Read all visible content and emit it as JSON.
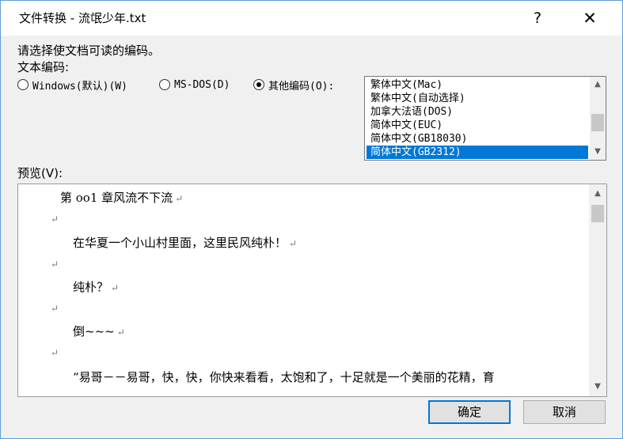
{
  "window": {
    "title": "文件转换 - 流氓少年.txt",
    "help_label": "?",
    "close_label": "✕"
  },
  "prompt": "请选择使文档可读的编码。",
  "encoding_label": "文本编码:",
  "radios": [
    {
      "label": "Windows(默认)(W)",
      "selected": false
    },
    {
      "label": "MS-DOS(D)",
      "selected": false
    },
    {
      "label": "其他编码(O):",
      "selected": true
    }
  ],
  "encodings": [
    "繁体中文(Mac)",
    "繁体中文(自动选择)",
    "加拿大法语(DOS)",
    "简体中文(EUC)",
    "简体中文(GB18030)",
    "简体中文(GB2312)"
  ],
  "selected_encoding": "简体中文(GB2312)",
  "preview_label": "预览(V):",
  "preview_lines": [
    "第 oo1 章风流不下流",
    "",
    "在华夏一个小山村里面，这里民风纯朴！",
    "",
    "纯朴？",
    "",
    "倒~~~",
    "",
    "“易哥－－易哥，快，快，你快来看看，太饱和了，十足就是一个美丽的花精，育"
  ],
  "paragraph_mark": "↵",
  "buttons": {
    "ok": "确定",
    "cancel": "取消"
  },
  "scroll": {
    "up": "▲",
    "down": "▼"
  },
  "colors": {
    "selection": "#0078d7",
    "border_accent": "#5f9ed8"
  }
}
